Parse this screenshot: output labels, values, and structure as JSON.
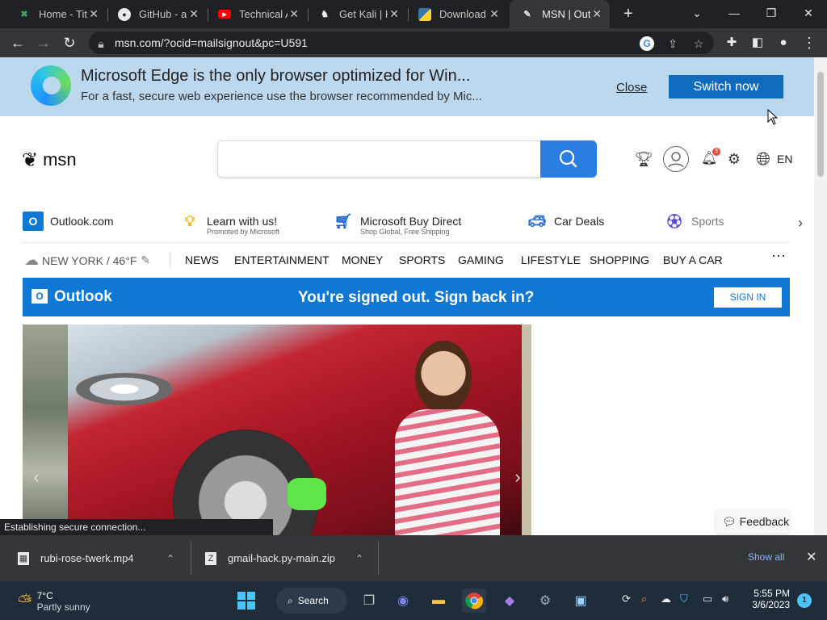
{
  "tabs": [
    {
      "title": "Home - Tita",
      "icon": "hackerrank-icon"
    },
    {
      "title": "GitHub - ak",
      "icon": "github-icon"
    },
    {
      "title": "Technical A",
      "icon": "youtube-icon"
    },
    {
      "title": "Get Kali | K",
      "icon": "kali-icon"
    },
    {
      "title": "Download",
      "icon": "python-icon"
    },
    {
      "title": "MSN | Outl",
      "icon": "msn-icon"
    }
  ],
  "address": {
    "url": "msn.com/?ocid=mailsignout&pc=U591"
  },
  "banner": {
    "title": "Microsoft Edge is the only browser optimized for Win...",
    "subtitle": "For a fast, secure web experience use the browser recommended by Mic...",
    "close_label": "Close",
    "switch_label": "Switch now"
  },
  "header": {
    "logo_text": "msn",
    "search_placeholder": "",
    "notification_count": "3",
    "language": "EN"
  },
  "quick_links": [
    {
      "label": "Outlook.com",
      "sub": "",
      "icon": "outlook-icon"
    },
    {
      "label": "Learn with us!",
      "sub": "Promoted by Microsoft",
      "icon": "lightbulb-icon"
    },
    {
      "label": "Microsoft Buy Direct",
      "sub": "Shop Global, Free Shipping",
      "icon": "cart-icon"
    },
    {
      "label": "Car Deals",
      "sub": "",
      "icon": "car-icon"
    },
    {
      "label": "Sports",
      "sub": "",
      "icon": "sports-icon"
    }
  ],
  "weather": {
    "text": "NEW YORK / 46°F"
  },
  "nav": [
    "NEWS",
    "ENTERTAINMENT",
    "MONEY",
    "SPORTS",
    "GAMING",
    "LIFESTYLE",
    "SHOPPING",
    "BUY A CAR"
  ],
  "outlook_bar": {
    "brand": "Outlook",
    "message": "You're signed out. Sign back in?",
    "signin": "SIGN IN"
  },
  "feedback_label": "Feedback",
  "status_text": "Establishing secure connection...",
  "downloads": {
    "items": [
      {
        "name": "rubi-rose-twerk.mp4"
      },
      {
        "name": "gmail-hack.py-main.zip"
      }
    ],
    "show_all": "Show all"
  },
  "taskbar": {
    "temp": "7°C",
    "condition": "Partly sunny",
    "search_label": "Search",
    "time": "5:55 PM",
    "date": "3/6/2023",
    "notification_count": "1"
  },
  "colors": {
    "accent": "#0f78d4",
    "banner_bg": "#bcd8ef",
    "search_button": "#2a7de1"
  }
}
